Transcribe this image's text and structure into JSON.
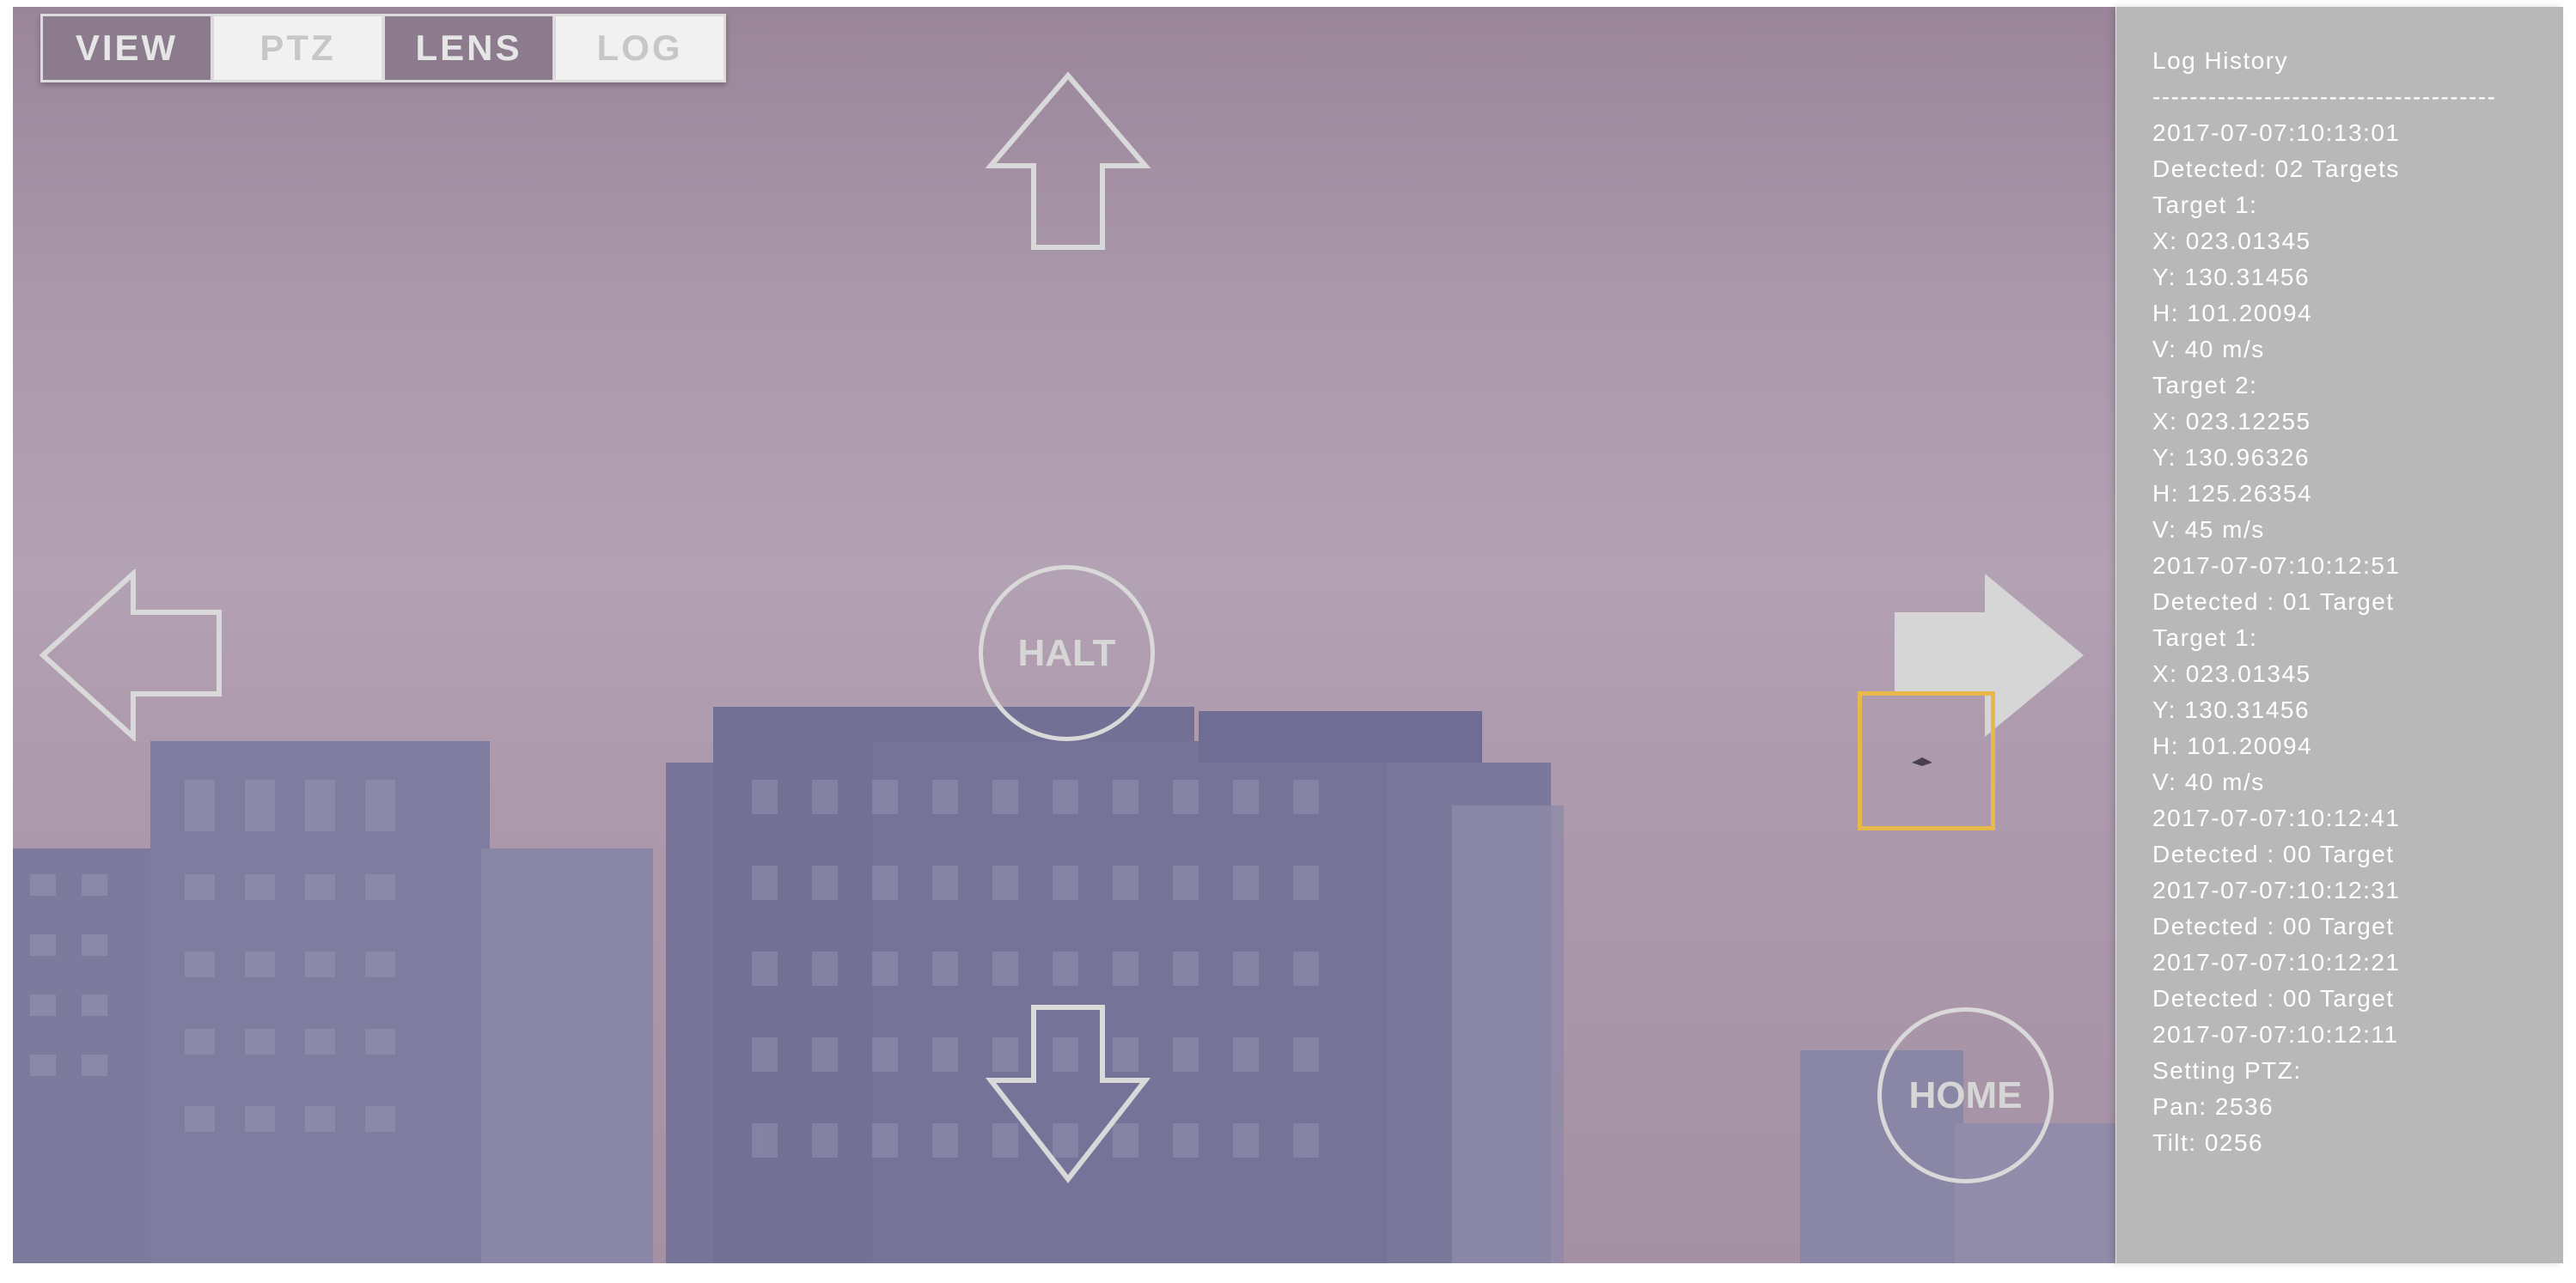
{
  "tabs": [
    {
      "label": "VIEW",
      "state": "dark"
    },
    {
      "label": "PTZ",
      "state": "light"
    },
    {
      "label": "LENS",
      "state": "dark"
    },
    {
      "label": "LOG",
      "state": "light"
    }
  ],
  "controls": {
    "halt_label": "HALT",
    "home_label": "HOME",
    "icons": [
      "arrow-up-icon",
      "arrow-down-icon",
      "arrow-left-icon",
      "arrow-right-icon"
    ]
  },
  "log": {
    "title": "Log History",
    "separator": "-------------------------------------",
    "lines": [
      "2017-07-07:10:13:01",
      "Detected: 02 Targets",
      "Target 1:",
      "X: 023.01345",
      "Y: 130.31456",
      "H: 101.20094",
      "V: 40 m/s",
      " Target 2:",
      "X: 023.12255",
      "Y: 130.96326",
      "H: 125.26354",
      "V: 45 m/s",
      "2017-07-07:10:12:51",
      "Detected : 01 Target",
      "Target 1:",
      "X: 023.01345",
      "Y: 130.31456",
      "H: 101.20094",
      "V: 40 m/s",
      "2017-07-07:10:12:41",
      "Detected : 00 Target",
      "2017-07-07:10:12:31",
      "Detected : 00 Target",
      "2017-07-07:10:12:21",
      "Detected : 00 Target",
      "2017-07-07:10:12:11",
      "Setting PTZ:",
      "Pan: 2536",
      "Tilt: 0256"
    ]
  },
  "colors": {
    "sky": "#a997aa",
    "buildings": "#7c7a9c",
    "control_stroke": "#d9d9d9",
    "target_box": "#e8b84a",
    "log_panel": "#b8b8b8"
  }
}
